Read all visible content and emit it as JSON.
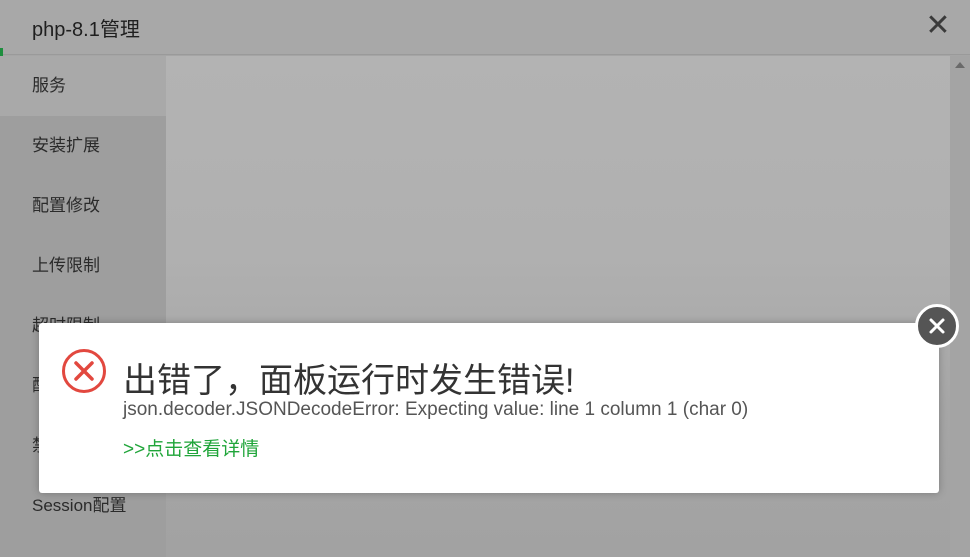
{
  "window": {
    "title": "php-8.1管理",
    "close_glyph": "✕"
  },
  "sidebar": {
    "items": [
      {
        "label": "服务",
        "active": true
      },
      {
        "label": "安装扩展",
        "active": false
      },
      {
        "label": "配置修改",
        "active": false
      },
      {
        "label": "上传限制",
        "active": false
      },
      {
        "label": "超时限制",
        "active": false
      },
      {
        "label": "配置文件",
        "active": false
      },
      {
        "label": "禁用函数",
        "active": false
      },
      {
        "label": "Session配置",
        "active": false
      }
    ]
  },
  "error": {
    "title": "出错了，面板运行时发生错误!",
    "message": "json.decoder.JSONDecodeError: Expecting value: line 1 column 1 (char 0)",
    "detail_link": ">>点击查看详情",
    "icon": "error-x-circle-icon"
  },
  "colors": {
    "accent_green": "#20a53a",
    "error_red": "#e2483f",
    "close_button": "#555555"
  }
}
